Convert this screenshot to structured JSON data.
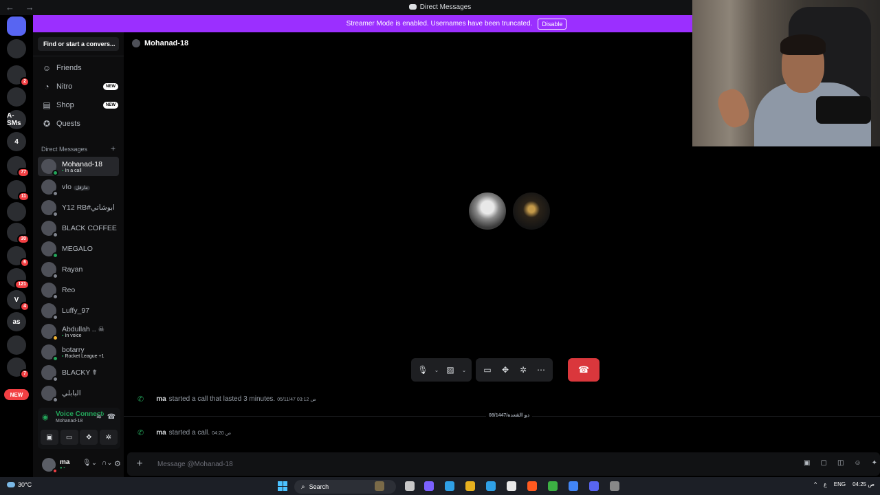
{
  "window": {
    "title": "Direct Messages",
    "nav": "← →"
  },
  "banner": {
    "text": "Streamer Mode is enabled. Usernames have been truncated.",
    "button": "Disable",
    "color": "#9b2fff"
  },
  "guilds": [
    {
      "label": "",
      "badge": "",
      "kind": "home"
    },
    {
      "label": "",
      "badge": ""
    },
    {
      "label": "",
      "badge": "2"
    },
    {
      "label": "",
      "badge": ""
    },
    {
      "label": "A-SMs",
      "badge": ""
    },
    {
      "label": "4",
      "badge": ""
    },
    {
      "label": "",
      "badge": "77"
    },
    {
      "label": "",
      "badge": "11"
    },
    {
      "label": "",
      "badge": ""
    },
    {
      "label": "",
      "badge": "30"
    },
    {
      "label": "",
      "badge": "6"
    },
    {
      "label": "",
      "badge": "121"
    },
    {
      "label": "V",
      "badge": "4"
    },
    {
      "label": "as",
      "badge": ""
    },
    {
      "label": "",
      "badge": ""
    },
    {
      "label": "",
      "badge": "7"
    }
  ],
  "guild_new": "NEW",
  "sidebar": {
    "search": "Find or start a convers...",
    "nav": [
      {
        "label": "Friends",
        "icon": "friends-icon",
        "glyph": "☺",
        "tag": ""
      },
      {
        "label": "Nitro",
        "icon": "nitro-icon",
        "glyph": "◔",
        "tag": "NEW"
      },
      {
        "label": "Shop",
        "icon": "shop-icon",
        "glyph": "▤",
        "tag": "NEW"
      },
      {
        "label": "Quests",
        "icon": "quests-icon",
        "glyph": "✪",
        "tag": ""
      }
    ],
    "dm_header": "Direct Messages",
    "dm_add": "+",
    "dms": [
      {
        "name": "Mohanad-18",
        "sub": "In a call",
        "status": "on",
        "active": true
      },
      {
        "name": "vIo",
        "sub": "",
        "status": "off",
        "tag": "مارفل"
      },
      {
        "name": "Y12 RB#ابوشاتي",
        "sub": "",
        "status": "off"
      },
      {
        "name": "BLACK COFFEE",
        "sub": "",
        "status": "off"
      },
      {
        "name": "MEGALO",
        "sub": "",
        "status": "on"
      },
      {
        "name": "Rayan",
        "sub": "",
        "status": "off"
      },
      {
        "name": "Reo",
        "sub": "",
        "status": "off"
      },
      {
        "name": "Luffy_97",
        "sub": "",
        "status": "off"
      },
      {
        "name": "Abdullah .. ☠",
        "sub": "In voice",
        "status": "idle"
      },
      {
        "name": "botarry",
        "sub": "Rocket League +1",
        "status": "on"
      },
      {
        "name": "BLACKY ☤",
        "sub": "",
        "status": "off"
      },
      {
        "name": "البابلي",
        "sub": "",
        "status": "off"
      }
    ]
  },
  "voice": {
    "title": "Voice Connected",
    "channel": "Mohanad-18"
  },
  "user": {
    "name": "ma",
    "sub": "● ▪"
  },
  "main": {
    "header_name": "Mohanad-18",
    "messages": [
      {
        "user": "ma",
        "text": "started a call that lasted 3 minutes.",
        "ts": "05/11/47 03:12 ص"
      },
      {
        "user": "ma",
        "text": "started a call.",
        "ts": "04:20 ص"
      }
    ],
    "date_divider": "08/1447/ذو القعدة",
    "composer_placeholder": "Message @Mohanad-18"
  },
  "taskbar": {
    "weather": "30°C",
    "search": "Search",
    "tray": [
      "^",
      "ع",
      "ENG",
      "04:25 ص"
    ]
  }
}
